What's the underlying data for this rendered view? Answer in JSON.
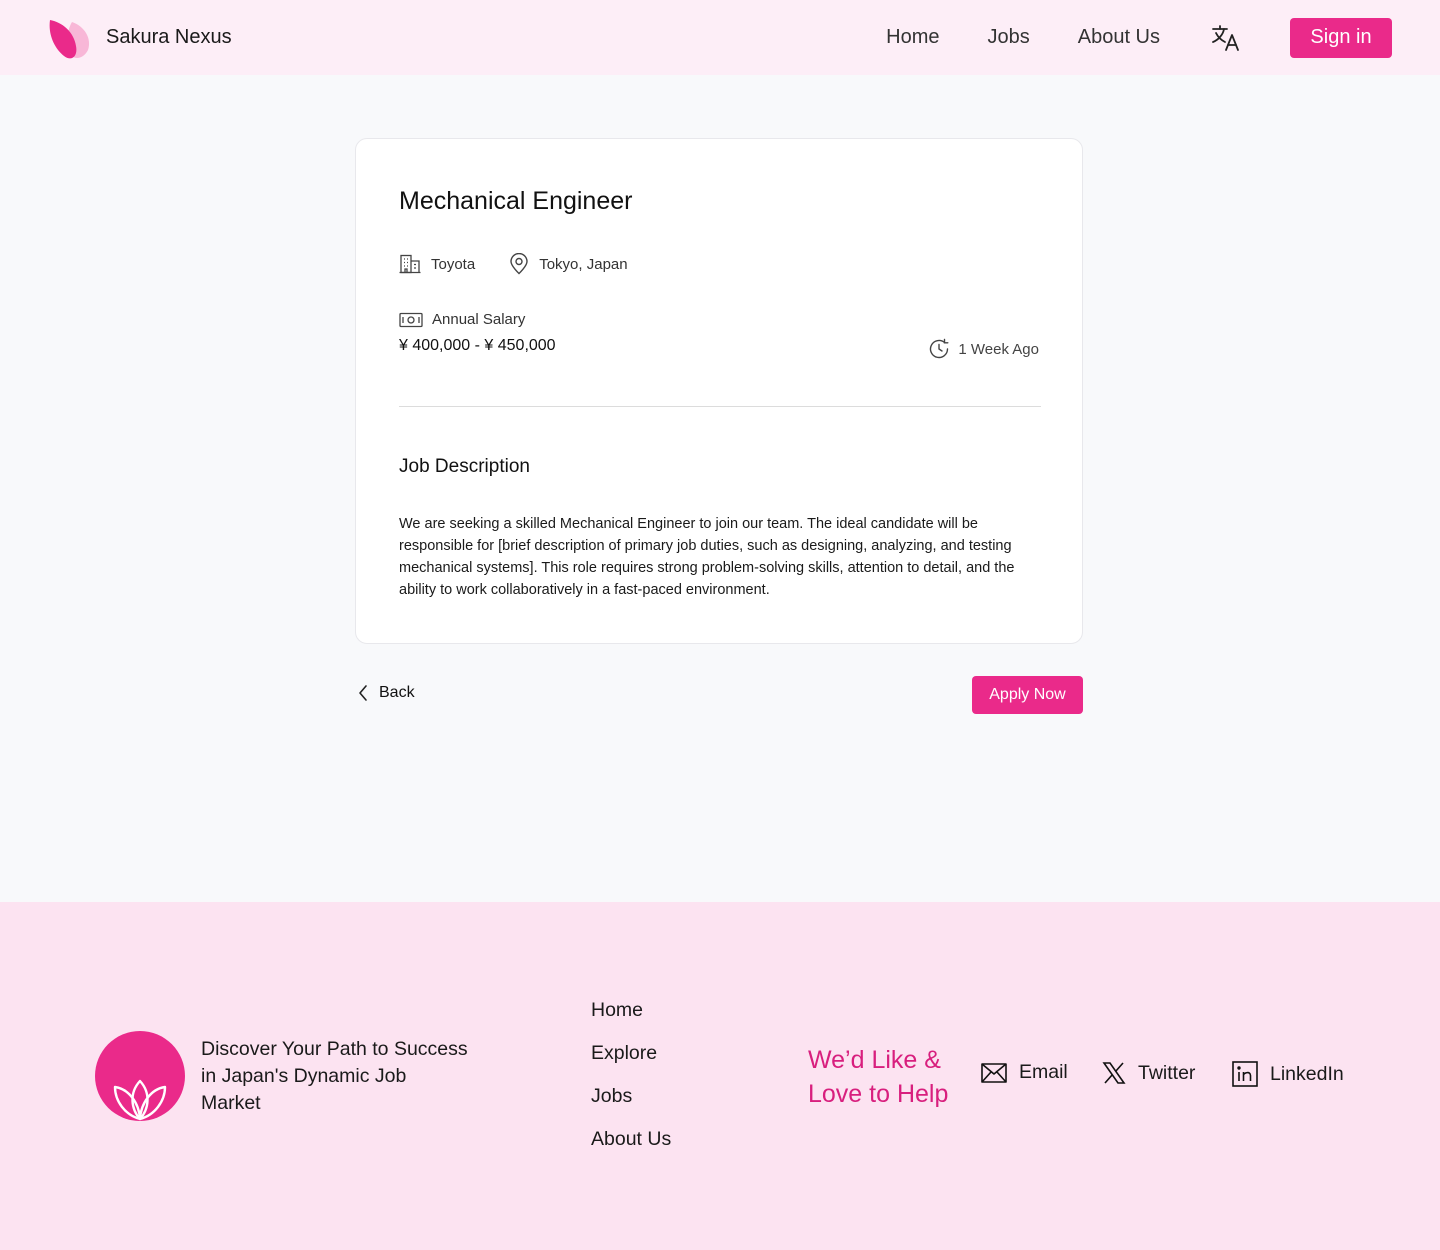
{
  "header": {
    "brand_name": "Sakura Nexus",
    "nav": [
      {
        "label": "Home"
      },
      {
        "label": "Jobs"
      },
      {
        "label": "About Us"
      }
    ],
    "language_icon": "translate-icon",
    "signin_label": "Sign in"
  },
  "job": {
    "title": "Mechanical Engineer",
    "company": "Toyota",
    "location": "Tokyo, Japan",
    "salary_label": "Annual Salary",
    "salary_range": "¥ 400,000 - ¥ 450,000",
    "posted": "1 Week Ago",
    "description_heading": "Job Description",
    "description": "We are seeking a skilled Mechanical Engineer to join our team. The ideal candidate will be responsible for [brief description of primary job duties, such as designing, analyzing, and testing mechanical systems]. This role requires strong problem-solving skills, attention to detail, and the ability to work collaboratively in a fast-paced environment."
  },
  "actions": {
    "back_label": "Back",
    "apply_label": "Apply Now"
  },
  "footer": {
    "tagline": "Discover Your Path to Success in Japan's Dynamic Job Market",
    "links": [
      {
        "label": "Home"
      },
      {
        "label": "Explore"
      },
      {
        "label": "Jobs"
      },
      {
        "label": "About Us"
      }
    ],
    "help_text": "We’d Like & Love to Help",
    "contacts": {
      "email": "Email",
      "twitter": "Twitter",
      "linkedin": "LinkedIn"
    }
  },
  "colors": {
    "accent": "#ea2a8a",
    "header_bg": "#fdeef7",
    "footer_bg": "#fce3f1",
    "page_bg": "#f8f9fb"
  }
}
